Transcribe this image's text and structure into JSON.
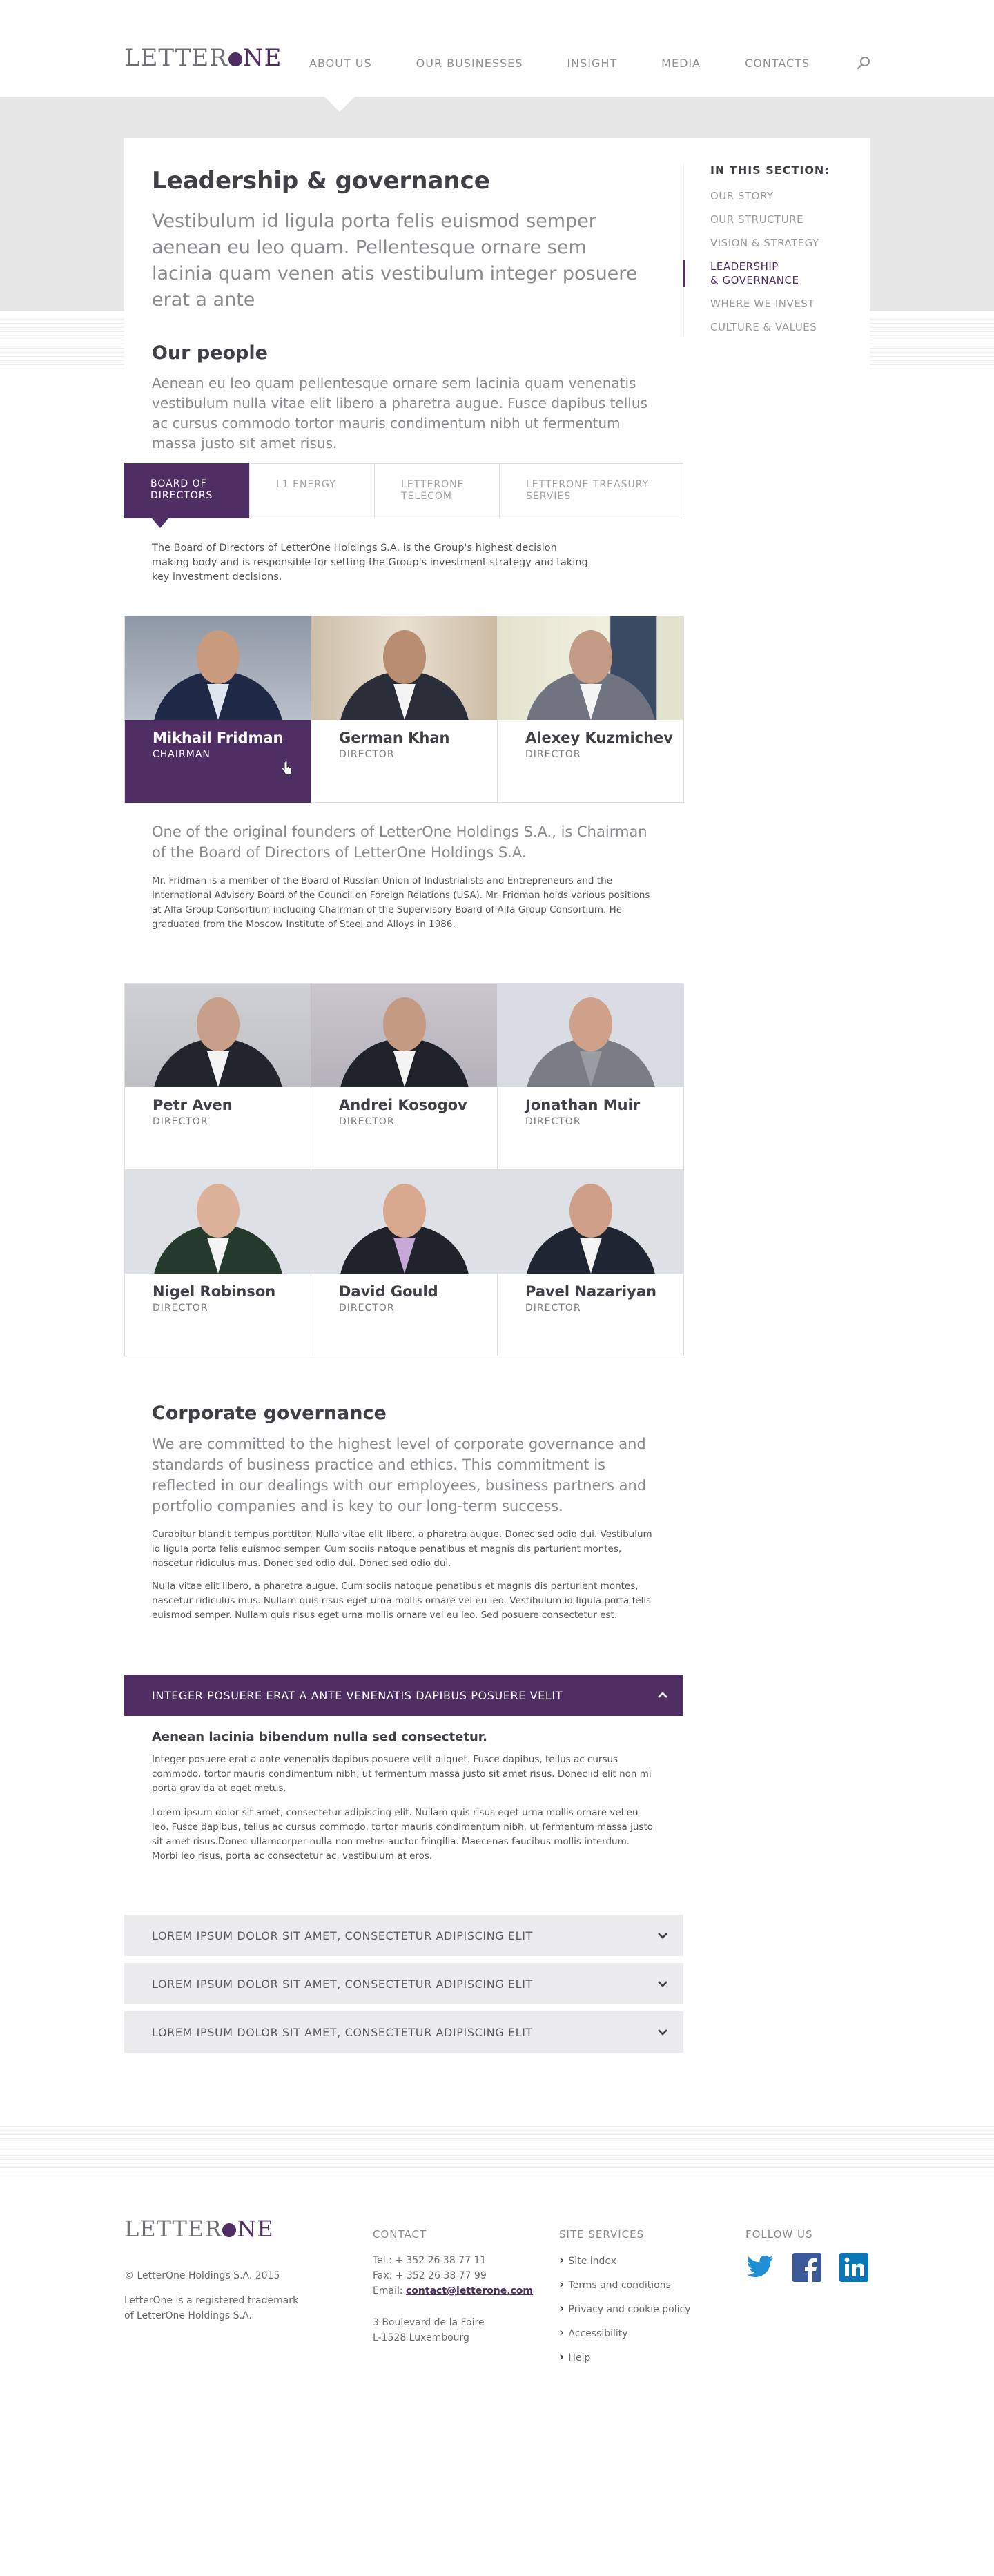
{
  "brand": {
    "logo_text": "LetterOne",
    "accent": "#4f2e64"
  },
  "nav": [
    "ABOUT US",
    "OUR BUSINESSES",
    "INSIGHT",
    "MEDIA",
    "CONTACTS"
  ],
  "page": {
    "title": "Leadership & governance",
    "lead": "Vestibulum id ligula porta felis euismod semper aenean eu leo quam. Pellentesque ornare sem lacinia quam venen atis vestibulum integer posuere erat a ante",
    "people_heading": "Our people",
    "people_text": "Aenean eu leo quam pellentesque ornare sem lacinia quam venenatis vestibulum nulla vitae elit libero a pharetra augue. Fusce dapibus tellus ac cursus commodo tortor mauris condimentum nibh ut fermentum massa justo sit amet risus."
  },
  "sidebar": {
    "title": "IN THIS SECTION:",
    "items": [
      {
        "label": "OUR STORY"
      },
      {
        "label": "OUR STRUCTURE"
      },
      {
        "label": "VISION & STRATEGY"
      },
      {
        "label": "LEADERSHIP\n& GOVERNANCE",
        "active": true
      },
      {
        "label": "WHERE WE INVEST"
      },
      {
        "label": "CULTURE & VALUES"
      }
    ]
  },
  "tabs": [
    {
      "label": "BOARD OF DIRECTORS",
      "active": true
    },
    {
      "label": "L1 ENERGY"
    },
    {
      "label": "LETTERONE TELECOM"
    },
    {
      "label": "LETTERONE TREASURY SERVIES"
    }
  ],
  "board_intro": "The Board of Directors of LetterOne Holdings S.A. is the Group's highest decision making body and is responsible for setting the Group's investment strategy and taking key investment decisions.",
  "people_top": [
    {
      "name": "Mikhail Fridman",
      "role": "CHAIRMAN",
      "selected": true
    },
    {
      "name": "German Khan",
      "role": "DIRECTOR"
    },
    {
      "name": "Alexey Kuzmichev",
      "role": "DIRECTOR"
    }
  ],
  "bio": {
    "lead": "One of the original founders of LetterOne Holdings S.A., is Chairman of the Board of Directors of LetterOne Holdings S.A.",
    "text": "Mr. Fridman is a member of the Board of Russian Union of Industrialists and Entrepreneurs and the International Advisory Board of the Council on Foreign Relations (USA). Mr. Fridman holds various positions at Alfa Group Consortium including Chairman of the Supervisory Board of Alfa Group Consortium. He graduated from the Moscow Institute of Steel and Alloys in 1986."
  },
  "people_bottom": [
    {
      "name": "Petr Aven",
      "role": "DIRECTOR"
    },
    {
      "name": "Andrei Kosogov",
      "role": "DIRECTOR"
    },
    {
      "name": "Jonathan Muir",
      "role": "DIRECTOR"
    },
    {
      "name": "Nigel Robinson",
      "role": "DIRECTOR"
    },
    {
      "name": "David Gould",
      "role": "DIRECTOR"
    },
    {
      "name": "Pavel Nazariyan",
      "role": "DIRECTOR"
    }
  ],
  "corporate": {
    "heading": "Corporate governance",
    "lead": "We are committed to the highest level of corporate governance and standards of business practice and ethics. This commitment is reflected in our dealings with our employees, business partners and portfolio companies and is key to our long-term success.",
    "text1": "Curabitur blandit tempus porttitor. Nulla vitae elit libero, a pharetra augue. Donec sed odio dui. Vestibulum id ligula porta felis euismod semper. Cum sociis natoque penatibus et magnis dis parturient montes, nascetur ridiculus mus. Donec sed odio dui. Donec sed odio dui.",
    "text2": "Nulla vitae elit libero, a pharetra augue. Cum sociis natoque penatibus et magnis dis parturient montes, nascetur ridiculus mus. Nullam quis risus eget urna mollis ornare vel eu leo. Vestibulum id ligula porta felis euismod semper. Nullam quis risus eget urna mollis ornare vel eu leo. Sed posuere consectetur est."
  },
  "accordion": {
    "open_label": "INTEGER POSUERE ERAT A ANTE VENENATIS DAPIBUS POSUERE VELIT",
    "open_heading": "Aenean lacinia bibendum nulla sed consectetur.",
    "open_p1": "Integer posuere erat a ante venenatis dapibus posuere velit aliquet. Fusce dapibus, tellus ac cursus commodo, tortor mauris condimentum nibh, ut fermentum massa justo sit amet risus. Donec id elit non mi porta gravida at eget metus.",
    "open_p2": "Lorem ipsum dolor sit amet, consectetur adipiscing elit. Nullam quis risus eget urna mollis ornare vel eu leo. Fusce dapibus, tellus ac cursus commodo, tortor mauris condimentum nibh, ut fermentum massa justo sit amet risus.Donec ullamcorper nulla non metus auctor fringilla. Maecenas faucibus mollis interdum. Morbi leo risus, porta ac consectetur ac, vestibulum at eros.",
    "closed_labels": [
      "LOREM IPSUM DOLOR SIT AMET, CONSECTETUR ADIPISCING ELIT",
      "LOREM IPSUM DOLOR SIT AMET, CONSECTETUR ADIPISCING ELIT",
      "LOREM IPSUM DOLOR SIT AMET, CONSECTETUR ADIPISCING ELIT"
    ]
  },
  "footer": {
    "copyright": "© LetterOne Holdings S.A. 2015",
    "trademark": "LetterOne is a registered trademark of LetterOne Holdings S.A.",
    "contact_title": "CONTACT",
    "tel": "Tel.: + 352 26 38 77 11",
    "fax": "Fax: + 352 26 38 77 99",
    "email_label": "Email:",
    "email": "contact@letterone.com",
    "address1": "3 Boulevard de la Foire",
    "address2": "L-1528 Luxembourg",
    "services_title": "SITE SERVICES",
    "services": [
      "Site index",
      "Terms and conditions",
      "Privacy and cookie policy",
      "Accessibility",
      "Help"
    ],
    "follow_title": "FOLLOW US",
    "social_icons": [
      "twitter-icon",
      "facebook-icon",
      "linkedin-icon"
    ]
  }
}
